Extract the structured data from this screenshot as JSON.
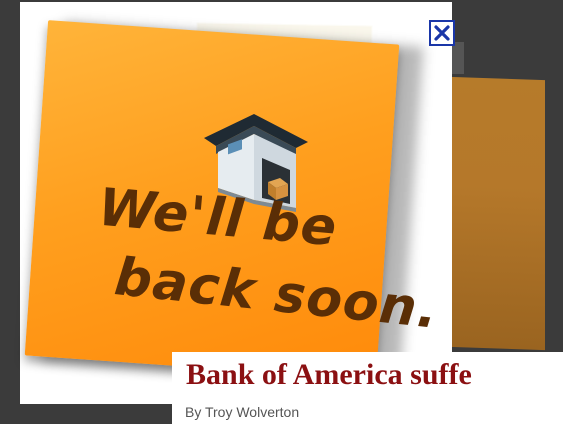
{
  "note": {
    "line1": "We'll be",
    "line2": "back soon."
  },
  "article": {
    "headline": "Bank of America suffe",
    "byline": "By Troy Wolverton"
  },
  "icons": {
    "close": "close-icon",
    "garage": "garage-icon"
  }
}
